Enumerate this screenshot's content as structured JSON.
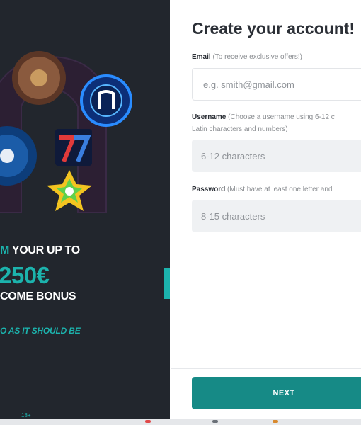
{
  "promo": {
    "line1_accent": "M",
    "line1_rest": " YOUR UP TO",
    "amount": "250€",
    "line3": "COME BONUS",
    "tagline": "O AS IT SHOULD BE",
    "age": "18+"
  },
  "form": {
    "title": "Create your account!",
    "email": {
      "label": "Email",
      "hint": "(To receive exclusive offers!)",
      "placeholder": "e.g. smith@gmail.com"
    },
    "username": {
      "label": "Username",
      "hint": "(Choose a username using 6-12 c",
      "hint_line2": "Latin characters and numbers)",
      "placeholder": "6-12 characters"
    },
    "password": {
      "label": "Password",
      "hint": "(Must have at least one letter and",
      "placeholder": "8-15 characters"
    },
    "next_label": "NEXT"
  },
  "colors": {
    "panel_bg": "#22262d",
    "accent": "#1cb3ad",
    "button": "#168a86"
  }
}
